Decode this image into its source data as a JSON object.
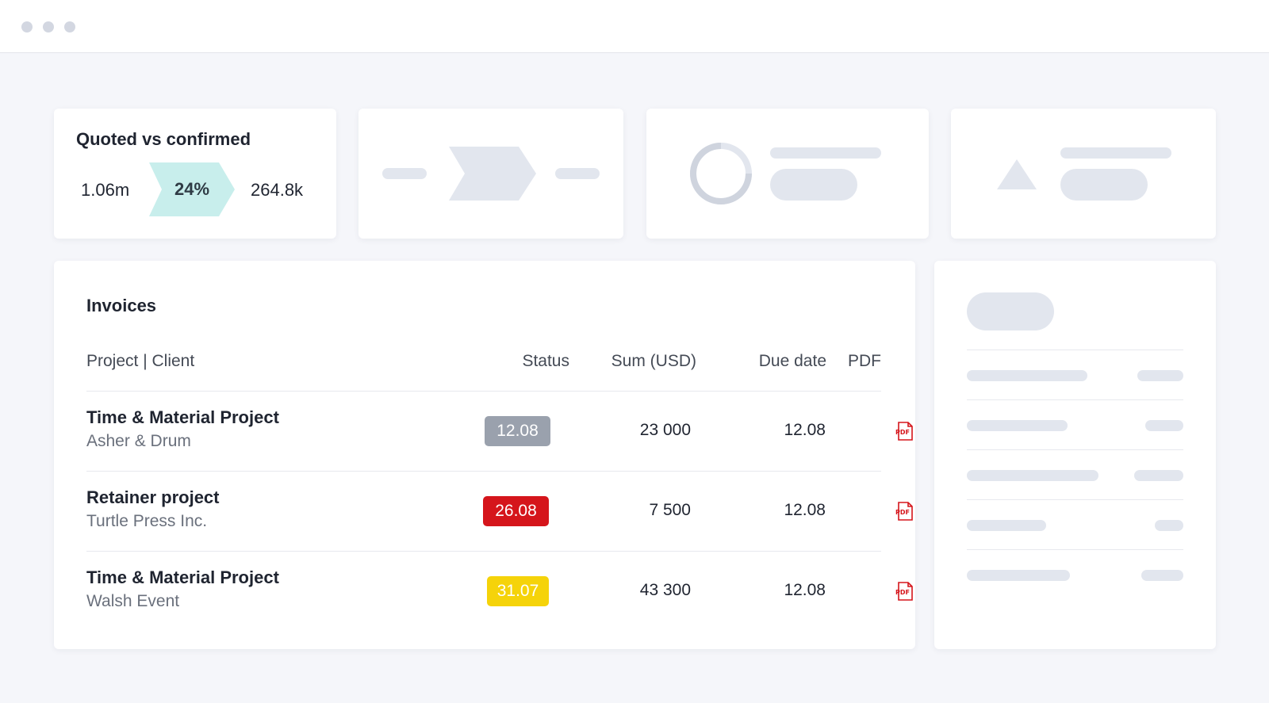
{
  "kpi": {
    "title": "Quoted vs confirmed",
    "quoted": "1.06m",
    "percent": "24%",
    "confirmed": "264.8k",
    "accent": "#c8eeec"
  },
  "invoices": {
    "title": "Invoices",
    "columns": [
      "Project | Client",
      "Status",
      "Sum (USD)",
      "Due date",
      "PDF"
    ],
    "rows": [
      {
        "project": "Time & Material Project",
        "client": "Asher & Drum",
        "status": "12.08",
        "status_color": "#9aa1ad",
        "sum": "23 000",
        "due": "12.08",
        "pdf_icon": "pdf-icon"
      },
      {
        "project": "Retainer project",
        "client": "Turtle Press Inc.",
        "status": "26.08",
        "status_color": "#d5151b",
        "sum": "7 500",
        "due": "12.08",
        "pdf_icon": "pdf-icon"
      },
      {
        "project": "Time & Material Project",
        "client": "Walsh Event",
        "status": "31.07",
        "status_color": "#f5d30a",
        "sum": "43 300",
        "due": "12.08",
        "pdf_icon": "pdf-icon"
      }
    ]
  },
  "colors": {
    "background": "#f5f6fa",
    "placeholder": "#e2e6ee",
    "pdf_red": "#d5151b"
  }
}
